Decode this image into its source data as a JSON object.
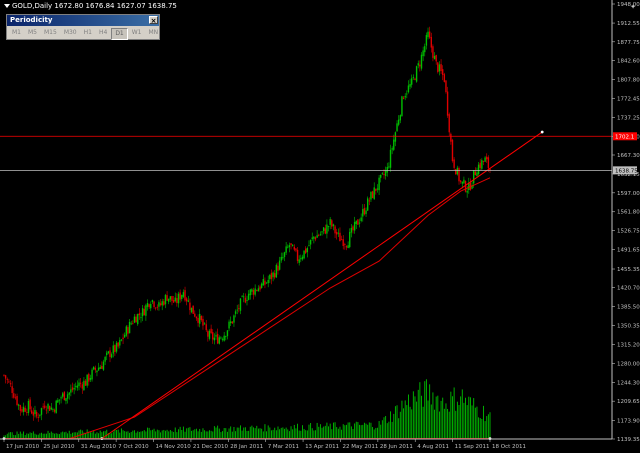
{
  "header": {
    "symbol_line": "GOLD,Daily  1672.80 1676.84 1627.07 1638.75"
  },
  "periodicity": {
    "title": "Periodicity",
    "close_glyph": "×",
    "buttons": [
      "M1",
      "M5",
      "M15",
      "M30",
      "H1",
      "H4",
      "D1",
      "W1",
      "MN"
    ],
    "selected": "D1"
  },
  "chart_data": {
    "type": "candlestick",
    "x_tick_labels": [
      "17 Jun 2010",
      "25 Jul 2010",
      "31 Aug 2010",
      "7 Oct 2010",
      "14 Nov 2010",
      "21 Dec 2010",
      "28 Jan 2011",
      "7 Mar 2011",
      "13 Apr 2011",
      "22 May 2011",
      "28 Jun 2011",
      "4 Aug 2011",
      "11 Sep 2011",
      "18 Oct 2011"
    ],
    "y_tick_labels": [
      "1948.00",
      "1912.55",
      "1877.75",
      "1842.60",
      "1807.80",
      "1772.45",
      "1737.25",
      "1702.10",
      "1667.30",
      "1632.15",
      "1597.00",
      "1561.80",
      "1526.75",
      "1491.65",
      "1455.35",
      "1420.70",
      "1385.50",
      "1350.35",
      "1315.20",
      "1280.00",
      "1244.30",
      "1209.65",
      "1173.90",
      "1139.35"
    ],
    "y_tick_values": [
      1948.0,
      1912.55,
      1877.75,
      1842.6,
      1807.8,
      1772.45,
      1737.25,
      1702.1,
      1667.3,
      1632.15,
      1597.0,
      1561.8,
      1526.75,
      1491.65,
      1455.35,
      1420.7,
      1385.5,
      1350.35,
      1315.2,
      1280.0,
      1244.3,
      1209.65,
      1173.9,
      1139.35
    ],
    "ylim": [
      1139.35,
      1948.0
    ],
    "close_path": [
      [
        0,
        1258
      ],
      [
        5,
        1232
      ],
      [
        10,
        1195
      ],
      [
        15,
        1200
      ],
      [
        20,
        1180
      ],
      [
        25,
        1205
      ],
      [
        30,
        1195
      ],
      [
        35,
        1218
      ],
      [
        40,
        1225
      ],
      [
        45,
        1240
      ],
      [
        50,
        1245
      ],
      [
        55,
        1265
      ],
      [
        60,
        1278
      ],
      [
        65,
        1300
      ],
      [
        70,
        1310
      ],
      [
        75,
        1340
      ],
      [
        80,
        1365
      ],
      [
        85,
        1375
      ],
      [
        90,
        1400
      ],
      [
        95,
        1385
      ],
      [
        100,
        1405
      ],
      [
        105,
        1392
      ],
      [
        110,
        1415
      ],
      [
        115,
        1380
      ],
      [
        120,
        1362
      ],
      [
        125,
        1332
      ],
      [
        130,
        1325
      ],
      [
        135,
        1335
      ],
      [
        140,
        1360
      ],
      [
        145,
        1390
      ],
      [
        150,
        1410
      ],
      [
        155,
        1420
      ],
      [
        160,
        1428
      ],
      [
        165,
        1445
      ],
      [
        170,
        1470
      ],
      [
        175,
        1500
      ],
      [
        180,
        1475
      ],
      [
        185,
        1490
      ],
      [
        190,
        1515
      ],
      [
        195,
        1522
      ],
      [
        200,
        1540
      ],
      [
        205,
        1515
      ],
      [
        210,
        1505
      ],
      [
        215,
        1532
      ],
      [
        220,
        1560
      ],
      [
        225,
        1590
      ],
      [
        230,
        1615
      ],
      [
        235,
        1640
      ],
      [
        240,
        1710
      ],
      [
        245,
        1780
      ],
      [
        250,
        1800
      ],
      [
        255,
        1840
      ],
      [
        260,
        1890
      ],
      [
        265,
        1835
      ],
      [
        270,
        1810
      ],
      [
        275,
        1660
      ],
      [
        280,
        1615
      ],
      [
        285,
        1605
      ],
      [
        290,
        1645
      ],
      [
        295,
        1658
      ],
      [
        298,
        1640
      ]
    ],
    "volume_profile": [
      [
        0,
        6
      ],
      [
        50,
        8
      ],
      [
        100,
        10
      ],
      [
        150,
        12
      ],
      [
        200,
        14
      ],
      [
        230,
        16
      ],
      [
        240,
        30
      ],
      [
        245,
        38
      ],
      [
        250,
        44
      ],
      [
        255,
        48
      ],
      [
        260,
        52
      ],
      [
        265,
        46
      ],
      [
        270,
        40
      ],
      [
        275,
        44
      ],
      [
        280,
        48
      ],
      [
        285,
        40
      ],
      [
        290,
        34
      ],
      [
        298,
        26
      ]
    ],
    "moving_averages": [
      {
        "color": "#e00000",
        "points": [
          [
            0,
            1140
          ],
          [
            40,
            1140
          ],
          [
            80,
            1180
          ],
          [
            120,
            1260
          ],
          [
            160,
            1340
          ],
          [
            200,
            1420
          ],
          [
            230,
            1470
          ],
          [
            260,
            1555
          ],
          [
            280,
            1600
          ],
          [
            298,
            1625
          ]
        ]
      }
    ],
    "trendlines": [
      {
        "color": "#ff0000",
        "from": [
          60,
          1140
        ],
        "to": [
          330,
          1710
        ]
      },
      {
        "color": "#ff0000",
        "from": [
          0,
          1140
        ],
        "to": [
          298,
          1140
        ]
      }
    ],
    "horizontal_levels": [
      {
        "value": 1702.1,
        "color": "#ff0000"
      },
      {
        "value": 1638.75,
        "color": "#c0c0c0"
      }
    ],
    "price_tags": [
      {
        "text": "1702.1",
        "value": 1702.1,
        "bg": "#ff0000",
        "fg": "#ffffff"
      },
      {
        "text": "1638.75",
        "value": 1638.75,
        "bg": "#c0c0c0",
        "fg": "#000000"
      }
    ],
    "colors": {
      "bull": "#00c000",
      "bear": "#e00000",
      "axis": "#c0c0c0",
      "volume": "#00c000",
      "marker": "#ffffff"
    }
  }
}
